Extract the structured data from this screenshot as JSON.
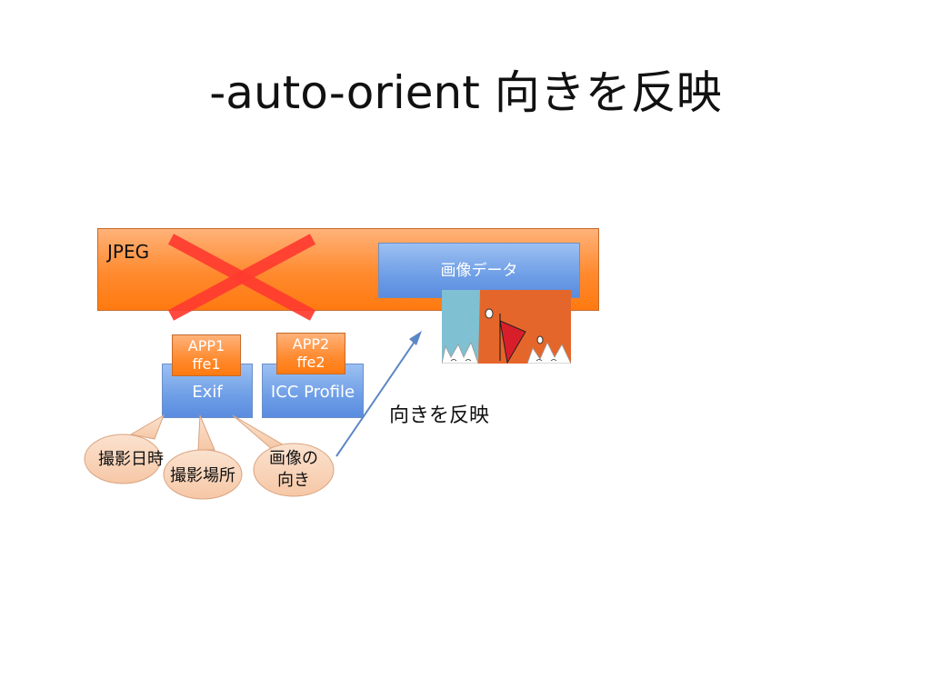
{
  "title": "-auto-orient 向きを反映",
  "diagram": {
    "jpeg_label": "JPEG",
    "image_data_label": "画像データ",
    "app1_label": "APP1\nffe1",
    "app1_line1": "APP1",
    "app1_line2": "ffe1",
    "app2_line1": "APP2",
    "app2_line2": "ffe2",
    "exif_label": "Exif",
    "icc_label": "ICC Profile",
    "callout_date": "撮影日時",
    "callout_place": "撮影場所",
    "callout_orient_line1": "画像の",
    "callout_orient_line2": "向き",
    "reflect_label": "向きを反映"
  },
  "colors": {
    "cross": "#ff3b30",
    "arrow": "#5b87c5",
    "blue_box": "#6e9ee6",
    "orange_box": "#ff8a2e"
  }
}
